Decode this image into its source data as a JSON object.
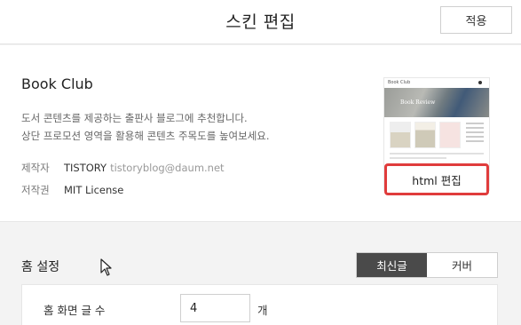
{
  "header": {
    "title": "스킨 편집",
    "apply_label": "적용"
  },
  "skin": {
    "name": "Book Club",
    "desc_line1": "도서 콘텐츠를 제공하는 출판사 블로그에 추천합니다.",
    "desc_line2": "상단 프로모션 영역을 활용해 콘텐츠 주목도를 높여보세요.",
    "maker_key": "제작자",
    "maker_name": "TISTORY",
    "maker_email": "tistoryblog@daum.net",
    "license_key": "저작권",
    "license_value": "MIT License",
    "thumb_title": "Book Club",
    "thumb_hero_text": "Book Review",
    "html_edit_label": "html 편집"
  },
  "home": {
    "title": "홈 설정",
    "tabs": [
      {
        "label": "최신글",
        "active": true
      },
      {
        "label": "커버",
        "active": false
      }
    ],
    "post_count_label": "홈 화면 글 수",
    "post_count_value": "4",
    "post_count_unit": "개"
  },
  "colors": {
    "highlight": "#e03c3c",
    "active_tab": "#4a4a4a"
  }
}
